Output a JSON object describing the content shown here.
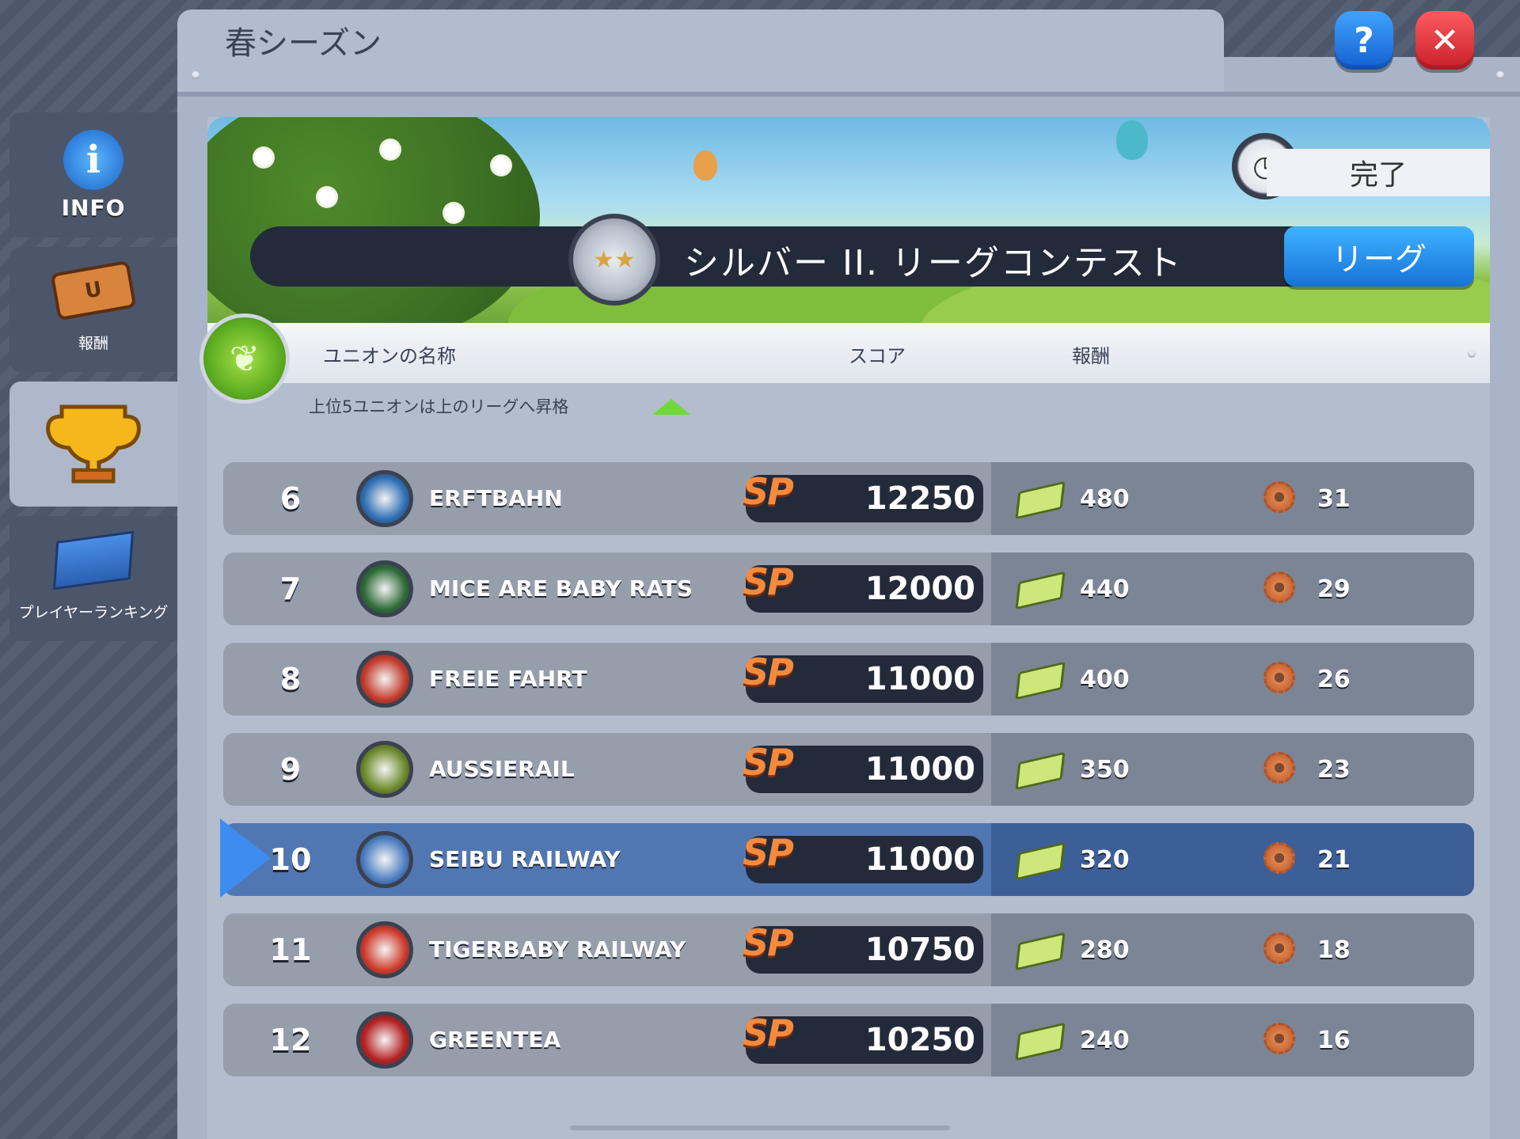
{
  "window": {
    "title": "春シーズン"
  },
  "sidebar": {
    "tabs": [
      {
        "label": "INFO",
        "icon": "info-icon",
        "active": false
      },
      {
        "label": "報酬",
        "icon": "ticket-icon",
        "active": false
      },
      {
        "label": "",
        "icon": "trophy-icon",
        "active": true
      },
      {
        "label": "プレイヤーランキング",
        "icon": "ranking-board-icon",
        "active": false
      }
    ]
  },
  "top_buttons": {
    "help": "?",
    "close": "✕"
  },
  "banner": {
    "status": "完了",
    "contest_title": "シルバー II. リーグコンテスト",
    "badge_stars": "★★",
    "league_button": "リーグ"
  },
  "columns": {
    "name": "ユニオンの名称",
    "score": "スコア",
    "reward": "報酬"
  },
  "promotion_note": "上位5ユニオンは上のリーグへ昇格",
  "score_icon_text": "SP",
  "rows": [
    {
      "rank": "6",
      "name": "ERFTBAHN",
      "score": "12250",
      "cash": "480",
      "gears": "31"
    },
    {
      "rank": "7",
      "name": "MICE ARE BABY RATS",
      "score": "12000",
      "cash": "440",
      "gears": "29"
    },
    {
      "rank": "8",
      "name": "FREIE FAHRT",
      "score": "11000",
      "cash": "400",
      "gears": "26"
    },
    {
      "rank": "9",
      "name": "AUSSIERAIL",
      "score": "11000",
      "cash": "350",
      "gears": "23"
    },
    {
      "rank": "10",
      "name": "SEIBU RAILWAY",
      "score": "11000",
      "cash": "320",
      "gears": "21",
      "highlighted": true
    },
    {
      "rank": "11",
      "name": "TIGERBABY RAILWAY",
      "score": "10750",
      "cash": "280",
      "gears": "18"
    },
    {
      "rank": "12",
      "name": "GREENTEA",
      "score": "10250",
      "cash": "240",
      "gears": "16"
    }
  ],
  "colors": {
    "highlight_row": "#5177b3",
    "league_button": "#1f8cf0",
    "close_button": "#e8343b",
    "help_button": "#1f7fe6",
    "sp_icon": "#f58a3d"
  }
}
